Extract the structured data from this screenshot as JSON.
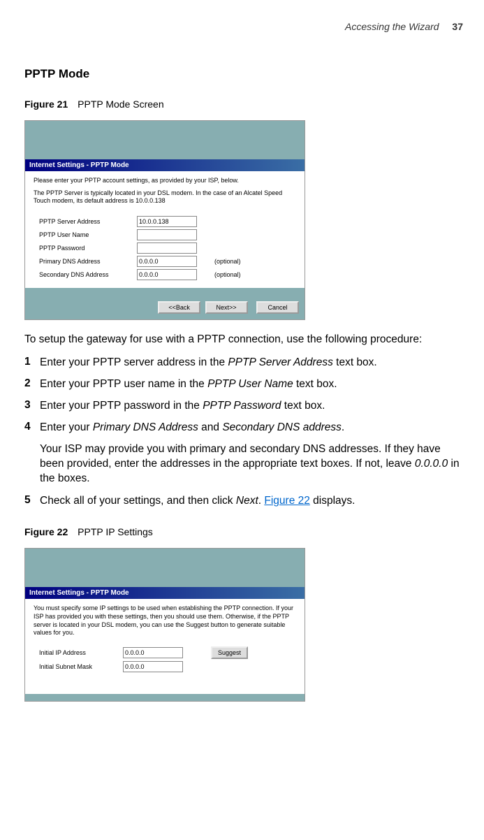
{
  "header": {
    "section": "Accessing the Wizard",
    "page": "37"
  },
  "section_title": "PPTP Mode",
  "figure21": {
    "label_bold": "Figure 21",
    "label_text": "PPTP Mode Screen",
    "titlebar": "Internet Settings - PPTP Mode",
    "intro1": "Please enter your PPTP account settings, as provided by your ISP, below.",
    "intro2": "The PPTP Server is typically located in your DSL modem. In the case of an Alcatel Speed Touch modem, its default address is 10.0.0.138",
    "fields": {
      "server_label": "PPTP Server Address",
      "server_value": "10.0.0.138",
      "user_label": "PPTP User Name",
      "user_value": "",
      "pass_label": "PPTP Password",
      "pass_value": "",
      "pdns_label": "Primary DNS Address",
      "pdns_value": "0.0.0.0",
      "pdns_optional": "(optional)",
      "sdns_label": "Secondary DNS Address",
      "sdns_value": "0.0.0.0",
      "sdns_optional": "(optional)"
    },
    "buttons": {
      "back": "<<Back",
      "next": "Next>>",
      "cancel": "Cancel"
    }
  },
  "intro_para": "To setup the gateway for use with a PPTP connection, use the following procedure:",
  "steps": {
    "s1a": "Enter your PPTP server address in the ",
    "s1b": "PPTP Server Address",
    "s1c": " text box.",
    "s2a": "Enter your PPTP user name in the ",
    "s2b": "PPTP User Name",
    "s2c": " text box.",
    "s3a": "Enter your PPTP password in the ",
    "s3b": "PPTP Password",
    "s3c": " text box.",
    "s4a": "Enter your ",
    "s4b": "Primary DNS Address",
    "s4c": " and ",
    "s4d": "Secondary DNS address",
    "s4e": ".",
    "s4_para_a": "Your ISP may provide you with primary and secondary DNS addresses. If they have been provided, enter the addresses in the appropriate text boxes. If not, leave ",
    "s4_para_b": "0.0.0.0",
    "s4_para_c": " in the boxes.",
    "s5a": "Check all of your settings, and then click ",
    "s5b": "Next",
    "s5c": ". ",
    "s5d": "Figure 22",
    "s5e": " displays."
  },
  "figure22": {
    "label_bold": "Figure 22",
    "label_text": "PPTP IP Settings",
    "titlebar": "Internet Settings - PPTP Mode",
    "intro": "You must specify some IP settings to be used when establishing the PPTP connection. If your ISP has provided you with these settings, then you should use them. Otherwise, if the PPTP server is located in your DSL modem, you can use the Suggest button to generate suitable values for you.",
    "fields": {
      "ip_label": "Initial IP Address",
      "ip_value": "0.0.0.0",
      "mask_label": "Initial Subnet Mask",
      "mask_value": "0.0.0.0",
      "suggest": "Suggest"
    }
  }
}
